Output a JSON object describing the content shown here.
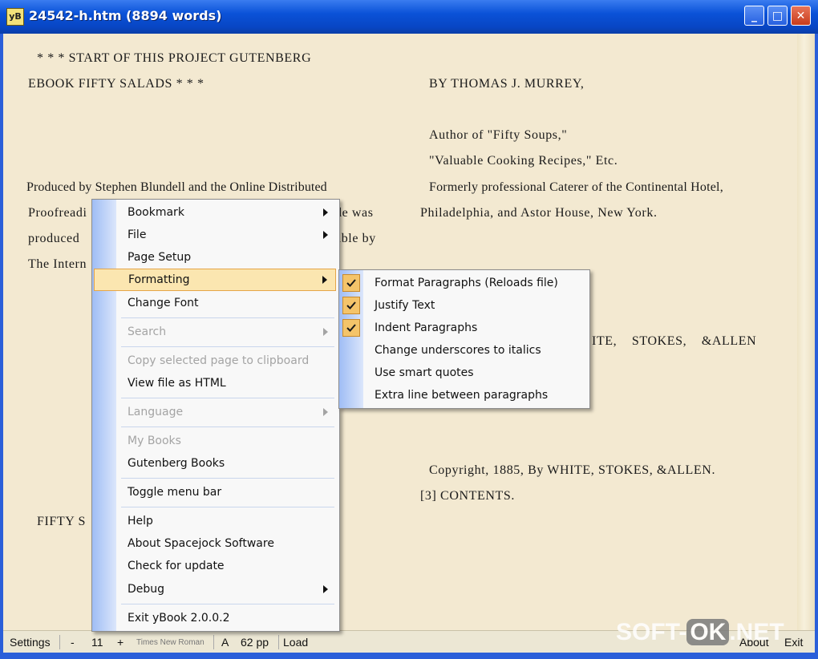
{
  "window": {
    "icon_text": "yB",
    "title": "24542-h.htm (8894 words)",
    "min_glyph": "_",
    "max_glyph": "□",
    "close_glyph": "✕"
  },
  "book": {
    "left_lines": [
      "* * * START OF THIS PROJECT GUTENBERG",
      "EBOOK FIFTY SALADS * * *",
      "Produced by Stephen Blundell and the Online Distributed",
      "Proofreadi",
      "de was",
      "produced",
      "able by",
      "The Intern",
      "FIFTY S"
    ],
    "right_lines": [
      "BY THOMAS J. MURREY,",
      "Author of \"Fifty Soups,\"",
      "\"Valuable Cooking Recipes,\" Etc.",
      "Formerly professional Caterer of the Continental Hotel,",
      "Philadelphia, and Astor House, New York.",
      "ITE, STOKES, &ALLEN",
      "Copyright, 1885, By WHITE, STOKES, &ALLEN.",
      "[3] CONTENTS."
    ]
  },
  "context_menu": {
    "items": [
      {
        "label": "Bookmark",
        "submenu": true
      },
      {
        "label": "File",
        "submenu": true
      },
      {
        "label": "Page Setup"
      },
      {
        "label": "Formatting",
        "submenu": true,
        "highlighted": true
      },
      {
        "label": "Change Font"
      },
      {
        "label": "Search",
        "submenu": true,
        "disabled": true
      },
      {
        "label": "Copy selected page to clipboard",
        "disabled": true
      },
      {
        "label": "View file as HTML"
      },
      {
        "label": "Language",
        "submenu": true,
        "disabled": true
      },
      {
        "label": "My Books",
        "disabled": true
      },
      {
        "label": "Gutenberg Books"
      },
      {
        "label": "Toggle menu bar"
      },
      {
        "label": "Help"
      },
      {
        "label": "About Spacejock Software"
      },
      {
        "label": "Check for update"
      },
      {
        "label": "Debug",
        "submenu": true
      },
      {
        "label": "Exit yBook 2.0.0.2"
      }
    ]
  },
  "formatting_submenu": {
    "items": [
      {
        "label": "Format Paragraphs (Reloads file)",
        "checked": true
      },
      {
        "label": "Justify Text",
        "checked": true
      },
      {
        "label": "Indent Paragraphs",
        "checked": true
      },
      {
        "label": "Change underscores to italics",
        "checked": false
      },
      {
        "label": "Use smart quotes",
        "checked": false
      },
      {
        "label": "Extra line between paragraphs",
        "checked": false
      }
    ]
  },
  "statusbar": {
    "settings": "Settings",
    "minus": "-",
    "font_size": "11",
    "plus": "+",
    "font_name": "Times New Roman",
    "font_icon": "A",
    "pages": "62 pp",
    "load": "Load",
    "about": "About",
    "exit": "Exit"
  },
  "watermark": {
    "part1": "SOFT-",
    "part2": "OK",
    "part3": ".NET"
  },
  "colors": {
    "page_bg": "#f3e9d1",
    "menu_highlight": "#fbe6b0",
    "check_bg": "#f4c46a",
    "titlebar": "#0a52d8"
  }
}
